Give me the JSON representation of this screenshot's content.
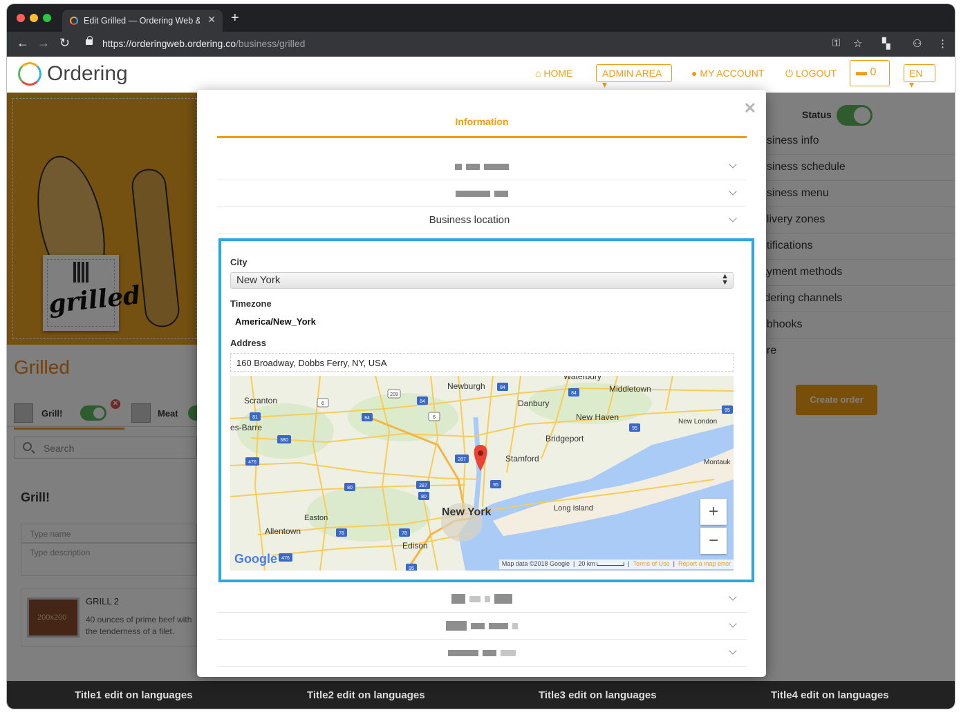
{
  "browser": {
    "tab_title": "Edit Grilled — Ordering Web &",
    "url_host": "https://orderingweb.ordering.co",
    "url_path": "/business/grilled"
  },
  "header": {
    "logo_text": "Ordering",
    "nav": {
      "home": "HOME",
      "admin_area": "ADMIN AREA",
      "my_account": "MY ACCOUNT",
      "logout": "LOGOUT",
      "cart_count": "0",
      "language": "EN"
    }
  },
  "store": {
    "brand_text": "grilled",
    "name": "Grilled",
    "categories": [
      {
        "label": "Grill!"
      },
      {
        "label": "Meat"
      }
    ],
    "search_placeholder": "Search",
    "section_title": "Grill!",
    "type_name_placeholder": "Type name",
    "type_description_placeholder": "Type description",
    "product": {
      "name": "GRILL 2",
      "description": "40 ounces of prime beef with the tenderness of a filet.",
      "image_label": "200x200"
    }
  },
  "right_panel": {
    "status_label": "Status",
    "items": [
      "usiness info",
      "usiness schedule",
      "usiness menu",
      "elivery zones",
      "otifications",
      "ayment methods",
      "rdering channels",
      "ebhooks",
      "ore"
    ],
    "create_order": "Create order"
  },
  "modal": {
    "tab_title": "Information",
    "accordion_section": "Business location",
    "city_label": "City",
    "city_value": "New York",
    "timezone_label": "Timezone",
    "timezone_value": "America/New_York",
    "address_label": "Address",
    "address_value": "160 Broadway, Dobbs Ferry, NY, USA",
    "map": {
      "labels": [
        "Waterbury",
        "Newburgh",
        "Middletown",
        "Scranton",
        "Danbury",
        "New Haven",
        "New London",
        "es-Barre",
        "Bridgeport",
        "Stamford",
        "Montauk",
        "Long Island",
        "Easton",
        "Allentown",
        "Edison"
      ],
      "highways": [
        "209",
        "84",
        "84",
        "84",
        "84",
        "6",
        "6",
        "81",
        "95",
        "95",
        "380",
        "287",
        "476",
        "80",
        "287",
        "80",
        "95",
        "78",
        "78",
        "476",
        "95"
      ],
      "main_city": "New York",
      "zoom_in": "+",
      "zoom_out": "−",
      "google": "Google",
      "map_data": "Map data ©2018 Google",
      "scale": "20 km",
      "terms": "Terms of Use",
      "report": "Report a map error"
    }
  },
  "footer": {
    "titles": [
      "Title1 edit on languages",
      "Title2 edit on languages",
      "Title3 edit on languages",
      "Title4 edit on languages"
    ]
  }
}
